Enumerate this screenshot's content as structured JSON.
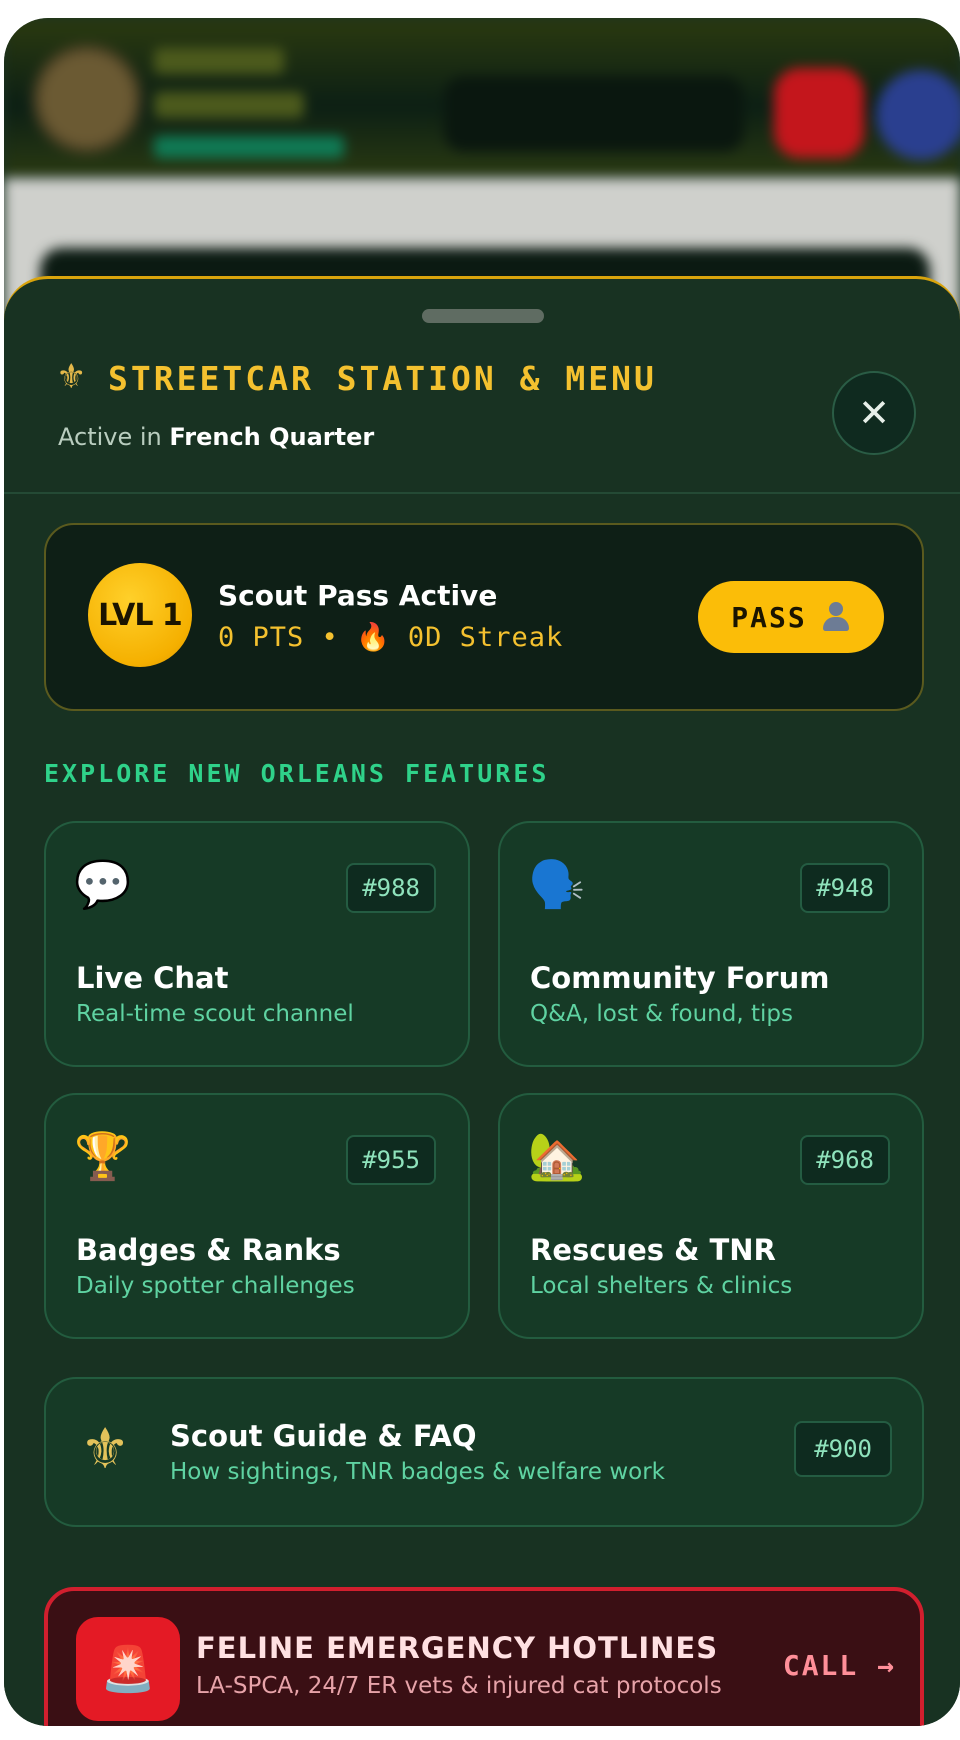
{
  "sheet": {
    "title_icon": "fleur-de-lis-icon",
    "title": "STREETCAR STATION & MENU",
    "subtitle_prefix": "Active in",
    "subtitle_location": "French Quarter",
    "close_icon": "close-icon"
  },
  "pass": {
    "level_label": "LVL 1",
    "title": "Scout Pass Active",
    "stats": "0 PTS • 🔥 0D Streak",
    "button_label": "PASS",
    "button_icon": "person-icon"
  },
  "section": {
    "label": "EXPLORE NEW ORLEANS FEATURES"
  },
  "features": [
    {
      "icon": "💬",
      "icon_name": "speech-bubble-icon",
      "badge": "#988",
      "title": "Live Chat",
      "desc": "Real-time scout channel"
    },
    {
      "icon": "🗣️",
      "icon_name": "speaking-head-icon",
      "badge": "#948",
      "title": "Community Forum",
      "desc": "Q&A, lost & found, tips"
    },
    {
      "icon": "🏆",
      "icon_name": "trophy-icon",
      "badge": "#955",
      "title": "Badges & Ranks",
      "desc": "Daily spotter challenges"
    },
    {
      "icon": "🏡",
      "icon_name": "house-with-garden-icon",
      "badge": "#968",
      "title": "Rescues & TNR",
      "desc": "Local shelters & clinics"
    }
  ],
  "guide": {
    "icon": "⚜",
    "icon_name": "fleur-de-lis-icon",
    "title": "Scout Guide & FAQ",
    "desc": "How sightings, TNR badges & welfare work",
    "badge": "#900"
  },
  "emergency": {
    "icon": "🚨",
    "icon_name": "siren-icon",
    "title": "FELINE EMERGENCY HOTLINES",
    "desc": "LA-SPCA, 24/7 ER vets & injured cat protocols",
    "cta": "CALL →"
  },
  "colors": {
    "sheet_bg": "#183222",
    "accent_gold": "#f4c12f",
    "accent_green": "#2fd28a",
    "emergency_red": "#d11f2e"
  }
}
